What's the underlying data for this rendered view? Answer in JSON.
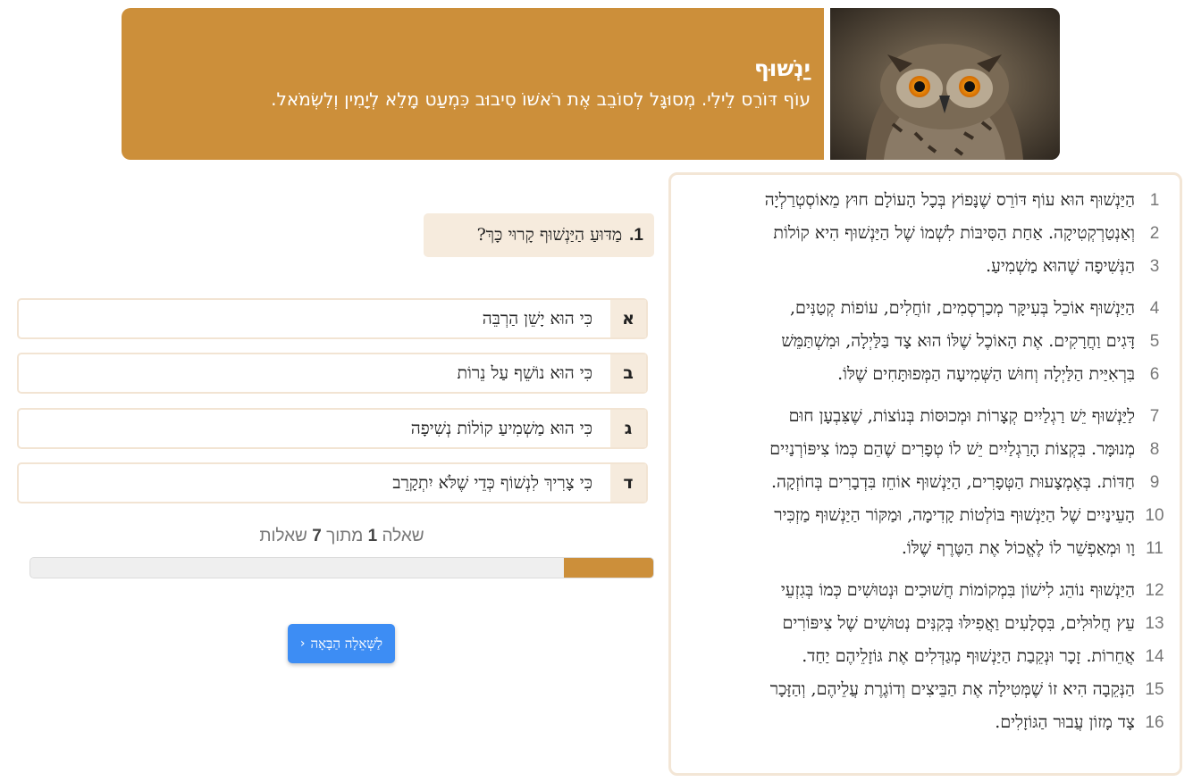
{
  "header": {
    "title": "יַנְשׁוּף",
    "subtitle": "עוֹף דּוֹרֵס לֵילִי. מְסוּגָּל לְסוֹבֵב אֶת רֹאשׁוֹ סִיבוּב כִּמְעַט מָלֵא לְיָמִין וְלִשְׂמֹאל.",
    "image": "owl-photo",
    "accent_color": "#cc8f3a"
  },
  "passage": {
    "paragraphs": [
      [
        {
          "num": "1",
          "text": "הַיַּנְשׁוּף הוּא עוֹף דּוֹרֵס שֶׁנָּפוֹץ בְּכָל הָעוֹלָם חוּץ מֵאוֹסְטְרַלְיָה"
        },
        {
          "num": "2",
          "text": "וְאַנְטַרְקְטִיקָה. אַחַת הַסִּיבּוֹת לִשְׁמוֹ שֶׁל הַיַּנְשׁוּף הִיא קוֹלוֹת"
        },
        {
          "num": "3",
          "text": "הַנְּשִׁיפָה שֶׁהוּא מַשְׁמִיעַ."
        }
      ],
      [
        {
          "num": "4",
          "text": "הַיַּנְשׁוּף אוֹכֵל בְּעִיקָּר מְכַרְסְמִים, זוֹחֲלִים, עוֹפוֹת קְטַנִּים,"
        },
        {
          "num": "5",
          "text": "דָּגִים וַחֲרָקִים. אֶת הָאוֹכֶל שֶׁלּוֹ הוּא צָד בַּלַּיְלָה, וּמִשְׁתַּמֵּשׁ"
        },
        {
          "num": "6",
          "text": "בִּרְאִיַּית הַלַּיְלָה וְחוּשׁ הַשְּׁמִיעָה הַמְּפוּתָּחִים שֶׁלּוֹ."
        }
      ],
      [
        {
          "num": "7",
          "text": "לַיַּנְשׁוּף יֵשׁ רַגְלַיִים קְצָרוֹת וּמְכוּסּוֹת בְּנוֹצוֹת, שֶׁצִּבְעָן חוּם"
        },
        {
          "num": "8",
          "text": "מְנוּמָּר. בִּקְצוֹת הָרַגְלַיִים יֵשׁ לוֹ טְפָרִים שֶׁהֵם כְּמוֹ צִיפּוֹרְנַיִים"
        },
        {
          "num": "9",
          "text": "חַדּוֹת. בְּאֶמְצָעוּת הַטְּפָרִים, הַיַּנְשׁוּף אוֹחֵז בִּדְבָרִים בְּחוֹזְקָה."
        },
        {
          "num": "10",
          "text": "הָעֵינַיִים שֶׁל הַיַּנְשׁוּף בּוֹלְטוֹת קָדִימָה, וּמַקּוֹר הַיַּנְשׁוּף מַזְכִּיר"
        },
        {
          "num": "11",
          "text": "וָו וּמְאַפְשֵׁר לוֹ לֶאֱכוֹל אֶת הַטֶּרֶף שֶׁלּוֹ."
        }
      ],
      [
        {
          "num": "12",
          "text": "הַיַּנְשׁוּף נוֹהֵג לִישׁוֹן בִּמְקוֹמוֹת חֲשׁוּכִים וּנְטוּשִׁים כְּמוֹ בְּגִזְעֵי"
        },
        {
          "num": "13",
          "text": "עֵץ חֲלוּלִים, בִּסְלָעִים וַאֲפִילּוּ בְּקִנִּים נְטוּשִׁים שֶׁל צִיפּוֹרִים"
        },
        {
          "num": "14",
          "text": "אֲחֵרוֹת. זָכָר וּנְקֵבַת הַיַּנְשׁוּף מְגַדְּלִים אֶת גּוֹזָלֵיהֶם יַחַד."
        },
        {
          "num": "15",
          "text": "הַנְּקֵבָה הִיא זוֹ שֶׁמְּטִילָה אֶת הַבֵּיצִים וְדוֹגֶרֶת עֲלֵיהֶם, וְהַזָּכָר"
        },
        {
          "num": "16",
          "text": "צָד מָזוֹן עֲבוּר הַגּוֹזָלִים."
        }
      ]
    ]
  },
  "question": {
    "number": "1.",
    "text": "מַדּוּעַ הַיַּנְשׁוּף קָרוּי כָּךְ?"
  },
  "answers": [
    {
      "letter": "א",
      "text": "כִּי הוּא יָשֵׁן הַרְבֵּה"
    },
    {
      "letter": "ב",
      "text": "כִּי הוּא נוֹשֵׁף עַל נֵרוֹת"
    },
    {
      "letter": "ג",
      "text": "כִּי הוּא מַשְׁמִיעַ קוֹלוֹת נְשִׁיפָה"
    },
    {
      "letter": "ד",
      "text": "כִּי צָרִיךְ לִנְשׁוֹף כְּדֵי שֶׁלֹּא יִתְקָרֵב"
    }
  ],
  "progress": {
    "word_question": "שאלה",
    "current": "1",
    "word_of": "מתוך",
    "total": "7",
    "word_questions": "שאלות",
    "fraction": 0.143,
    "fill_color": "#cc8f3a"
  },
  "next_button": {
    "label": "לַשְּׁאֵלָה הַבָּאָה",
    "icon": "chevron-left-icon",
    "color": "#3d8df4"
  }
}
